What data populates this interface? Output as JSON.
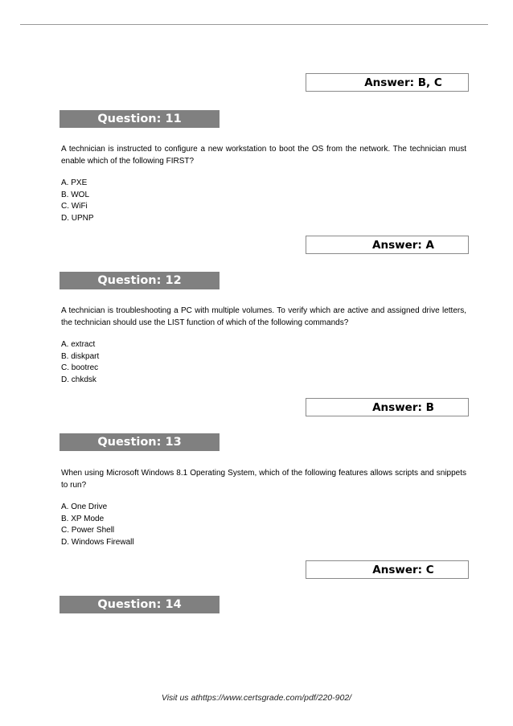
{
  "page": {
    "footer": "Visit us athttps://www.certsgrade.com/pdf/220-902/"
  },
  "answers": [
    {
      "label": "Answer: B, C"
    },
    {
      "label": "Answer: A"
    },
    {
      "label": "Answer: B"
    },
    {
      "label": "Answer: C"
    }
  ],
  "questions": [
    {
      "heading": "Question: 11",
      "stem": "A technician is instructed to configure a new workstation to boot the OS from the network. The technician must enable which of the following FIRST?",
      "options": [
        "A. PXE",
        "B. WOL",
        "C. WiFi",
        "D. UPNP"
      ]
    },
    {
      "heading": "Question: 12",
      "stem": "A technician is troubleshooting a PC with multiple volumes. To verify which are active and assigned drive letters, the technician should use the LIST function of which of the following commands?",
      "options": [
        "A. extract",
        "B. diskpart",
        "C. bootrec",
        "D. chkdsk"
      ]
    },
    {
      "heading": "Question: 13",
      "stem": "When using Microsoft Windows 8.1 Operating System, which of the following features allows scripts and snippets to run?",
      "options": [
        "A. One Drive",
        "B. XP Mode",
        "C. Power Shell",
        "D. Windows Firewall"
      ]
    },
    {
      "heading": "Question: 14"
    }
  ]
}
